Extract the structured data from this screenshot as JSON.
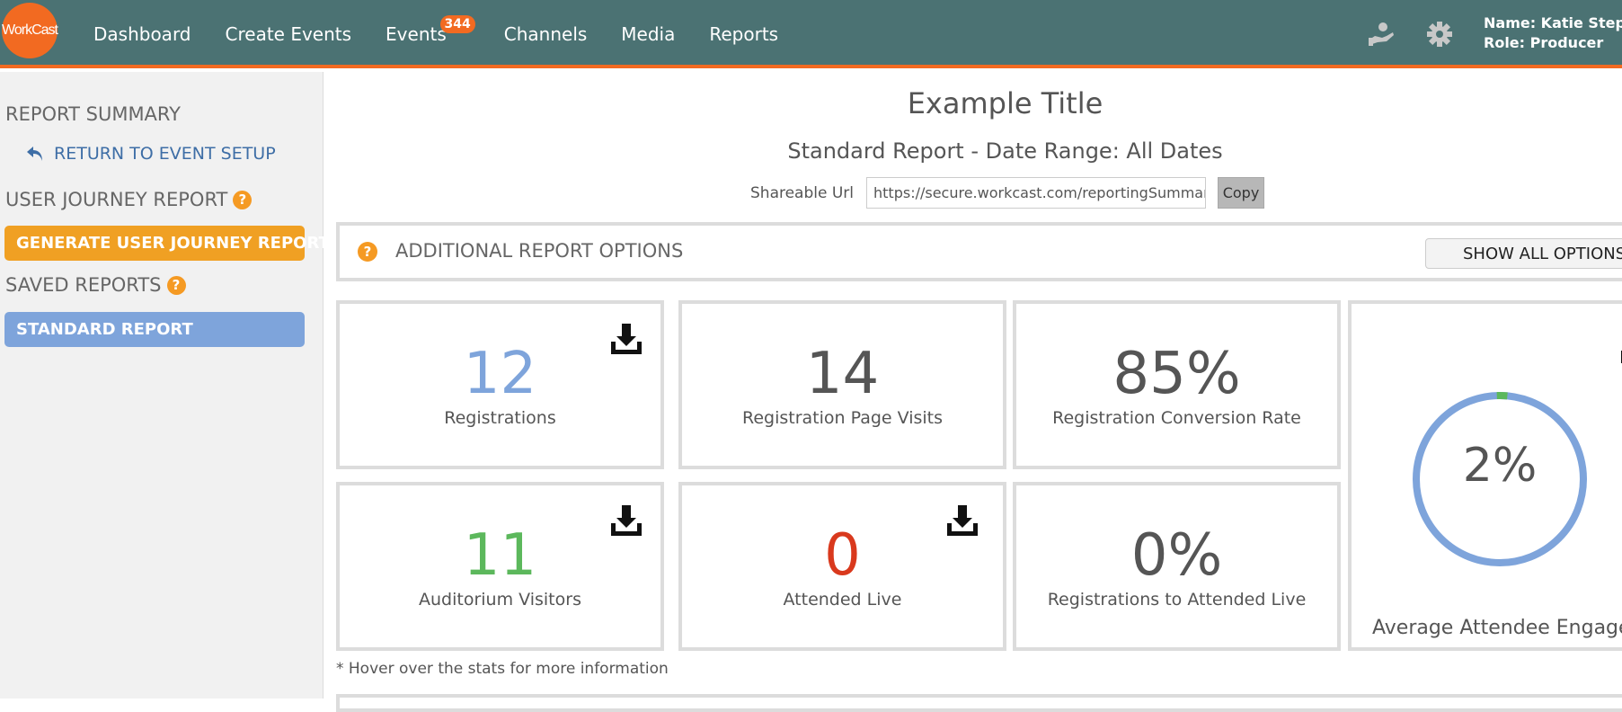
{
  "app": {
    "logo_text": "WorkCast",
    "nav": [
      {
        "label": "Dashboard"
      },
      {
        "label": "Create Events"
      },
      {
        "label": "Events",
        "badge": "344"
      },
      {
        "label": "Channels"
      },
      {
        "label": "Media"
      },
      {
        "label": "Reports"
      }
    ],
    "icons": [
      "hand-coin-icon",
      "gear-icon"
    ],
    "user": {
      "name_line": "Name: Katie Stepher",
      "role_line": "Role: Producer"
    }
  },
  "sidebar": {
    "report_summary": "REPORT SUMMARY",
    "return_link": "RETURN TO EVENT SETUP",
    "user_journey_heading": "USER JOURNEY REPORT",
    "generate_button": "GENERATE USER JOURNEY REPORT",
    "saved_reports_heading": "SAVED REPORTS",
    "standard_report_button": "STANDARD REPORT",
    "help_glyph": "?"
  },
  "main": {
    "title": "Example Title",
    "subtitle": "Standard Report - Date Range: All Dates",
    "share": {
      "label": "Shareable Url",
      "url": "https://secure.workcast.com/reportingSummary.",
      "copy_label": "Copy"
    },
    "options": {
      "title": "ADDITIONAL REPORT OPTIONS",
      "show_all_label": "SHOW ALL OPTIONS"
    },
    "stats": [
      {
        "value": "12",
        "label": "Registrations",
        "color": "#7ea4db",
        "download": true
      },
      {
        "value": "14",
        "label": "Registration Page Visits",
        "color": "#555555",
        "download": false
      },
      {
        "value": "85%",
        "label": "Registration Conversion Rate",
        "color": "#555555",
        "download": false
      },
      {
        "value": "11",
        "label": "Auditorium Visitors",
        "color": "#5cb85c",
        "download": true
      },
      {
        "value": "0",
        "label": "Attended Live",
        "color": "#d9391d",
        "download": true
      },
      {
        "value": "0%",
        "label": "Registrations to Attended Live",
        "color": "#555555",
        "download": false
      }
    ],
    "engagement": {
      "value": "2%",
      "fraction": 0.02,
      "label": "Average Attendee Engagem",
      "ring_color": "#7ea4db",
      "fill_color": "#5cb85c"
    },
    "hover_note": "* Hover over the stats for more information"
  },
  "colors": {
    "nav_bg": "#4b7273",
    "accent": "#f26a21",
    "help": "#f59a23"
  }
}
